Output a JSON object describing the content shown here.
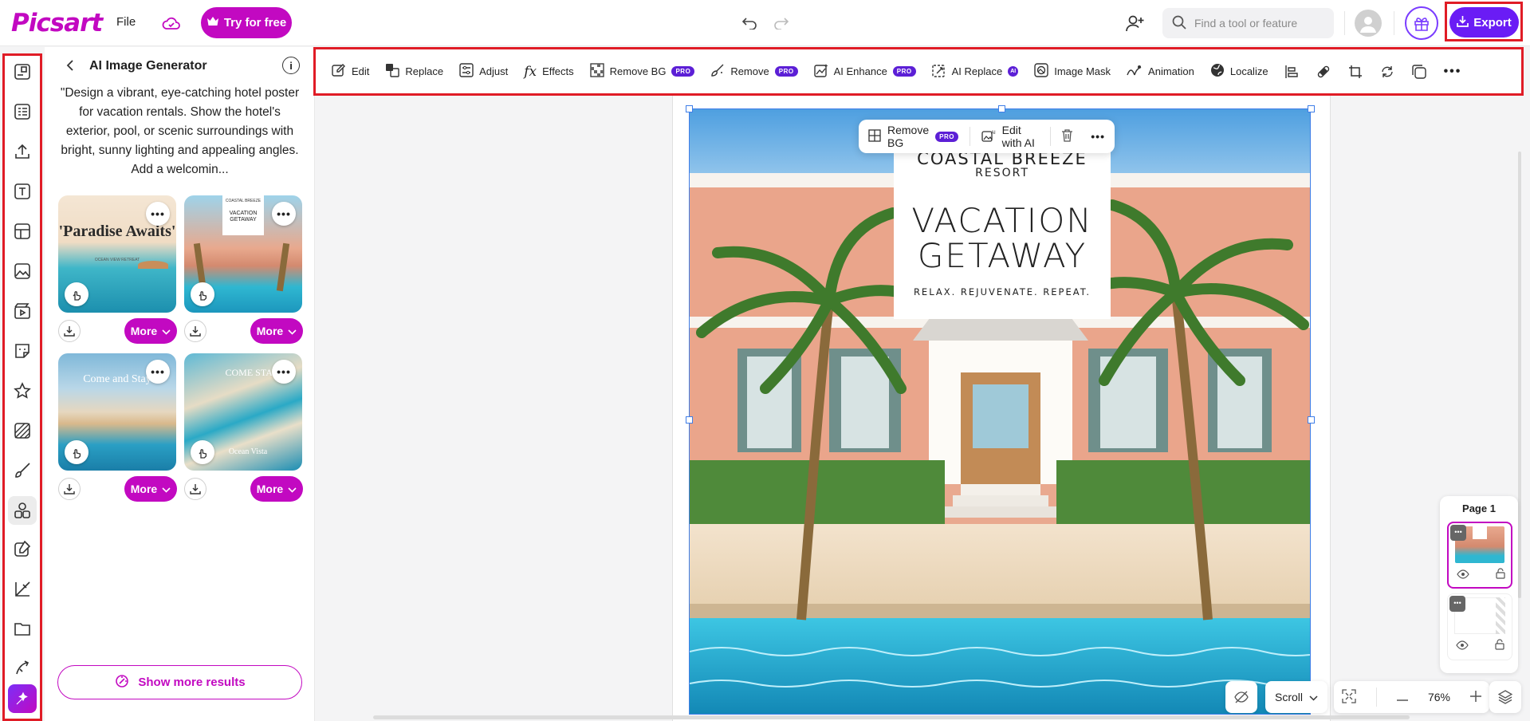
{
  "app": {
    "logo": "Picsart",
    "file_label": "File",
    "try_label": "Try for free",
    "export_label": "Export"
  },
  "search": {
    "placeholder": "Find a tool or feature"
  },
  "panel": {
    "title": "AI Image Generator",
    "info": "i",
    "prompt": "\"Design a vibrant, eye-catching hotel poster for vacation rentals. Show the hotel's exterior, pool, or scenic surroundings with bright, sunny lighting and appealing angles. Add a welcomin...",
    "results": [
      {
        "headline": "'Paradise Awaits'",
        "sub": "OCEAN VIEW RETREAT",
        "style": "beach"
      },
      {
        "headline": "VACATION GETAWAY",
        "sub": "COASTAL BREEZE",
        "style": "hotel"
      },
      {
        "headline": "Come and Stay",
        "sub": "",
        "style": "beach2"
      },
      {
        "headline": "COME STAY",
        "sub": "Ocean Vista",
        "style": "pool"
      }
    ],
    "more_label": "More",
    "show_more": "Show more results"
  },
  "toolbar": {
    "items": [
      {
        "label": "Edit",
        "icon": "edit-icon",
        "pro": false
      },
      {
        "label": "Replace",
        "icon": "replace-icon",
        "pro": false
      },
      {
        "label": "Adjust",
        "icon": "adjust-icon",
        "pro": false
      },
      {
        "label": "Effects",
        "icon": "fx-icon",
        "pro": false
      },
      {
        "label": "Remove BG",
        "icon": "remove-bg-icon",
        "pro": true
      },
      {
        "label": "Remove",
        "icon": "eraser-brush-icon",
        "pro": true
      },
      {
        "label": "AI Enhance",
        "icon": "enhance-icon",
        "pro": true
      },
      {
        "label": "AI Replace",
        "icon": "ai-replace-icon",
        "pro": false,
        "ai": true
      },
      {
        "label": "Image Mask",
        "icon": "mask-icon",
        "pro": false
      },
      {
        "label": "Animation",
        "icon": "animation-icon",
        "pro": false
      },
      {
        "label": "Localize",
        "icon": "globe-icon",
        "pro": false
      }
    ],
    "pro_badge": "PRO",
    "ai_badge": "AI"
  },
  "floating": {
    "remove_bg": "Remove BG",
    "pro_badge": "PRO",
    "edit_ai": "Edit with AI"
  },
  "poster": {
    "resort": "COASTAL BREEZE",
    "resort_sub": "RESORT",
    "main_line1": "VACATION",
    "main_line2": "GETAWAY",
    "tagline": "RELAX. REJUVENATE. REPEAT."
  },
  "pages": {
    "title": "Page 1"
  },
  "bottom": {
    "scroll_label": "Scroll",
    "zoom": "76%"
  },
  "colors": {
    "brand": "#c209c1",
    "export": "#6a1cf5",
    "highlight": "#e01c26",
    "selection": "#3f7ee8"
  }
}
